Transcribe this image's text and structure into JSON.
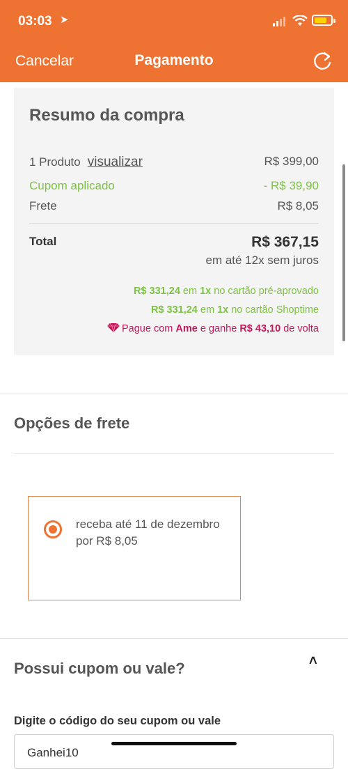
{
  "status": {
    "time": "03:03",
    "location_icon": "location-arrow-icon"
  },
  "nav": {
    "cancel": "Cancelar",
    "title": "Pagamento",
    "refresh_icon": "refresh-icon"
  },
  "summary": {
    "title": "Resumo da compra",
    "products_label": "1 Produto",
    "view_link": "visualizar",
    "products_value": "R$ 399,00",
    "coupon_label": "Cupom aplicado",
    "coupon_value": "- R$ 39,90",
    "freight_label": "Frete",
    "freight_value": "R$ 8,05",
    "total_label": "Total",
    "total_value": "R$ 367,15",
    "installments": "em até 12x sem juros",
    "promo1": {
      "amount": "R$ 331,24",
      "mid": " em ",
      "times": "1x",
      "rest": " no cartão pré-aprovado"
    },
    "promo2": {
      "amount": "R$ 331,24",
      "mid": " em ",
      "times": "1x",
      "rest": " no cartão Shoptime"
    },
    "promo3": {
      "pre": "Pague com ",
      "brand": "Ame",
      "mid": " e ganhe ",
      "amount": "R$ 43,10",
      "rest": " de volta"
    }
  },
  "shipping": {
    "title": "Opções de frete",
    "option": "receba até 11 de dezembro por R$ 8,05",
    "selected": true
  },
  "coupon": {
    "title": "Possui cupom ou vale?",
    "field_label": "Digite o código do seu cupom ou vale",
    "value": "Ganhei10"
  },
  "colors": {
    "brand": "#ee7232",
    "green": "#7dc242",
    "pink": "#c2185b"
  }
}
